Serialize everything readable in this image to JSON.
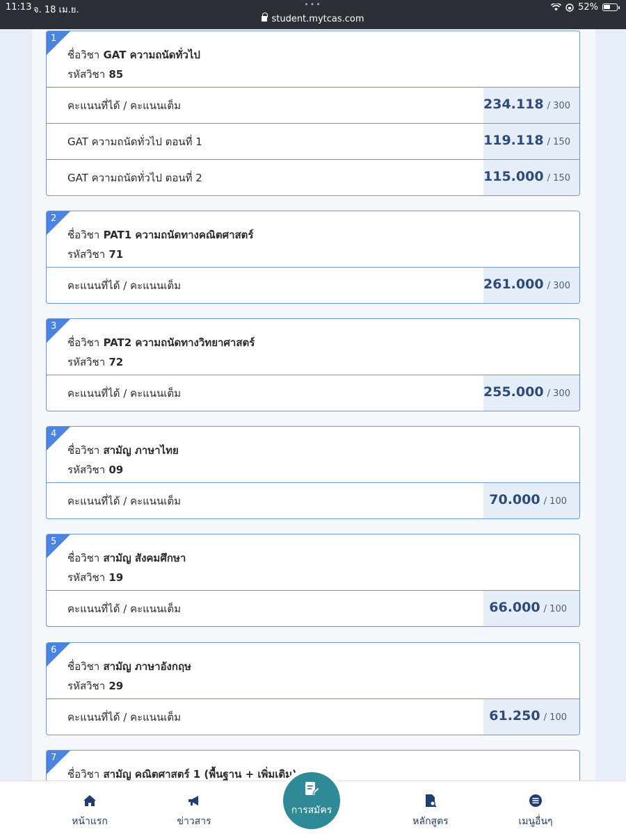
{
  "status": {
    "time": "11:13",
    "date": "จ. 18 เม.ย.",
    "url": "student.mytcas.com",
    "battery": "52%",
    "dots": "•••"
  },
  "subject_prefix": "ชื่อวิชา",
  "code_prefix": "รหัสวิชา",
  "cards": [
    {
      "num": "1",
      "name": "GAT ความถนัดทั่วไป",
      "code": "85",
      "rows": [
        {
          "label": "คะแนนที่ได้ / คะแนนเต็ม",
          "value": "234.118",
          "max": "/ 300"
        },
        {
          "label": "GAT ความถนัดทั่วไป ตอนที่ 1",
          "value": "119.118",
          "max": "/ 150"
        },
        {
          "label": "GAT ความถนัดทั่วไป ตอนที่ 2",
          "value": "115.000",
          "max": "/ 150"
        }
      ]
    },
    {
      "num": "2",
      "name": "PAT1 ความถนัดทางคณิตศาสตร์",
      "code": "71",
      "rows": [
        {
          "label": "คะแนนที่ได้ / คะแนนเต็ม",
          "value": "261.000",
          "max": "/ 300"
        }
      ]
    },
    {
      "num": "3",
      "name": "PAT2 ความถนัดทางวิทยาศาสตร์",
      "code": "72",
      "rows": [
        {
          "label": "คะแนนที่ได้ / คะแนนเต็ม",
          "value": "255.000",
          "max": "/ 300"
        }
      ]
    },
    {
      "num": "4",
      "name": "สามัญ ภาษาไทย",
      "code": "09",
      "rows": [
        {
          "label": "คะแนนที่ได้ / คะแนนเต็ม",
          "value": "70.000",
          "max": "/ 100"
        }
      ]
    },
    {
      "num": "5",
      "name": "สามัญ สังคมศึกษา",
      "code": "19",
      "rows": [
        {
          "label": "คะแนนที่ได้ / คะแนนเต็ม",
          "value": "66.000",
          "max": "/ 100"
        }
      ]
    },
    {
      "num": "6",
      "name": "สามัญ ภาษาอังกฤษ",
      "code": "29",
      "rows": [
        {
          "label": "คะแนนที่ได้ / คะแนนเต็ม",
          "value": "61.250",
          "max": "/ 100"
        }
      ]
    },
    {
      "num": "7",
      "name": "สามัญ คณิตศาสตร์ 1 (พื้นฐาน + เพิ่มเติม)",
      "code": "",
      "rows": []
    }
  ],
  "nav": {
    "home": "หน้าแรก",
    "news": "ข่าวสาร",
    "apply": "การสมัคร",
    "courses": "หลักสูตร",
    "more": "เมนูอื่นๆ"
  }
}
